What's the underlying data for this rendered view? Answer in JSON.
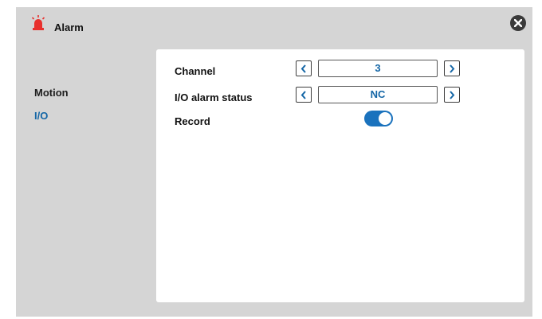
{
  "header": {
    "title": "Alarm",
    "icon": "alarm-siren-icon",
    "close_icon": "close-icon"
  },
  "sidebar": {
    "items": [
      {
        "label": "Motion",
        "active": false
      },
      {
        "label": "I/O",
        "active": true
      }
    ]
  },
  "settings": {
    "channel": {
      "label": "Channel",
      "value": "3"
    },
    "io_status": {
      "label": "I/O alarm status",
      "value": "NC"
    },
    "record": {
      "label": "Record",
      "enabled": true
    }
  },
  "colors": {
    "accent": "#1a72bd",
    "active_text": "#1466a6",
    "alarm_red": "#e8312e",
    "background": "#d5d5d5"
  }
}
